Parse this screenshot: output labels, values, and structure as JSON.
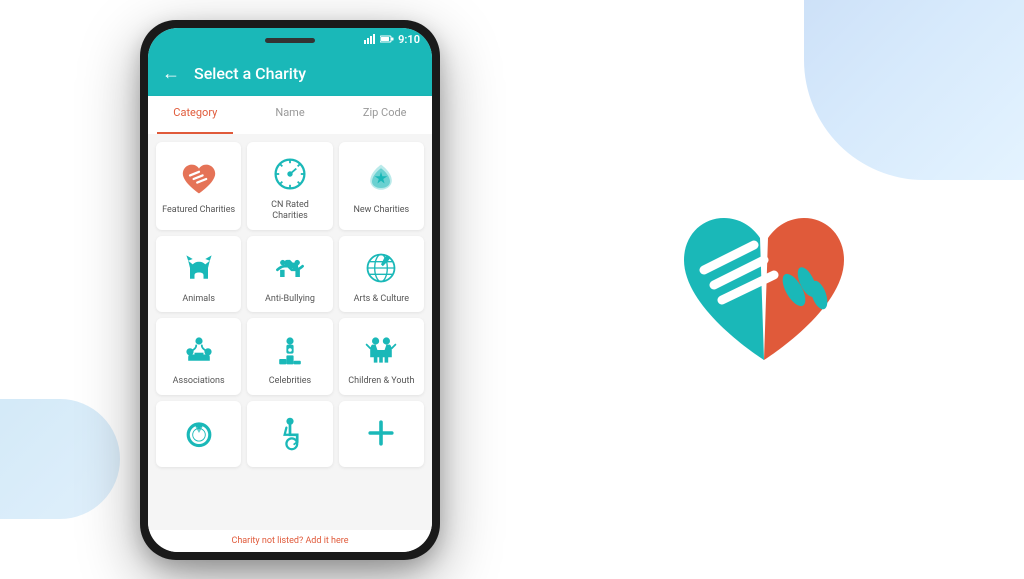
{
  "background": {
    "shape_top_right": "top-right decorative blue gradient",
    "shape_bottom_left": "bottom-left decorative blue gradient"
  },
  "phone": {
    "status_bar": {
      "time": "9:10",
      "icons": [
        "signal",
        "battery"
      ]
    },
    "header": {
      "back_label": "←",
      "title": "Select a Charity"
    },
    "tabs": [
      {
        "label": "Category",
        "active": true
      },
      {
        "label": "Name",
        "active": false
      },
      {
        "label": "Zip Code",
        "active": false
      }
    ],
    "grid": [
      {
        "id": "featured",
        "label": "Featured Charities",
        "icon": "handshake-heart"
      },
      {
        "id": "cn-rated",
        "label": "CN Rated Charities",
        "icon": "compass"
      },
      {
        "id": "new",
        "label": "New Charities",
        "icon": "handshake-star"
      },
      {
        "id": "animals",
        "label": "Animals",
        "icon": "cat"
      },
      {
        "id": "anti-bullying",
        "label": "Anti-Bullying",
        "icon": "handshake"
      },
      {
        "id": "arts",
        "label": "Arts & Culture",
        "icon": "arts"
      },
      {
        "id": "associations",
        "label": "Associations",
        "icon": "people-circle"
      },
      {
        "id": "celebrities",
        "label": "Celebrities",
        "icon": "trophy-person"
      },
      {
        "id": "children",
        "label": "Children & Youth",
        "icon": "children"
      },
      {
        "id": "wedding",
        "label": "",
        "icon": "ring"
      },
      {
        "id": "disability",
        "label": "",
        "icon": "wheelchair"
      },
      {
        "id": "add",
        "label": "",
        "icon": "plus"
      }
    ],
    "bottom_hint": {
      "prefix": "Charity not listed? ",
      "link": "Add it here"
    }
  },
  "logo": {
    "alt": "CharityNavigator heart logo"
  }
}
